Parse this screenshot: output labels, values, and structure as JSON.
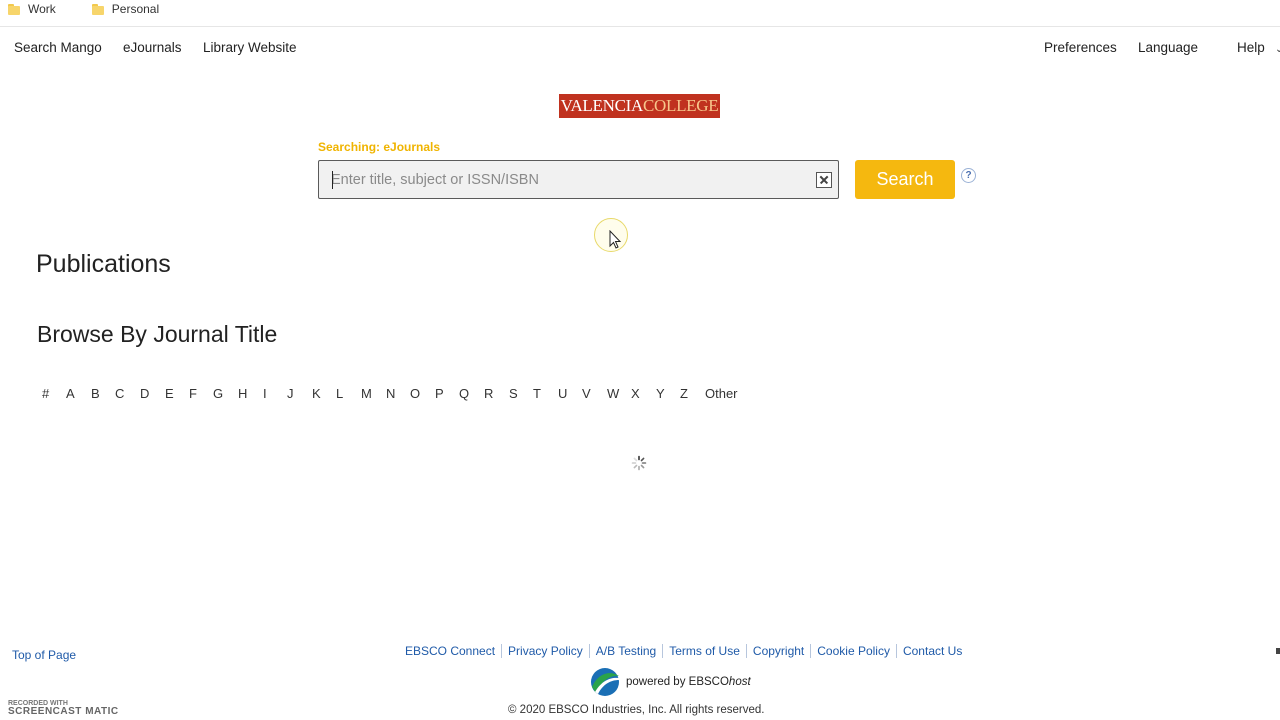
{
  "bookmarks": [
    {
      "label": "Work"
    },
    {
      "label": "Personal"
    }
  ],
  "topnav": {
    "left": [
      "Search Mango",
      "eJournals",
      "Library Website"
    ],
    "right": [
      "Preferences",
      "Language",
      "Help"
    ]
  },
  "logo": {
    "part1": "VALENCIA",
    "part2": "COLLEGE"
  },
  "search": {
    "searching_label": "Searching: eJournals",
    "placeholder": "Enter title, subject or ISSN/ISBN",
    "value": "",
    "button_label": "Search",
    "help_label": "?"
  },
  "main": {
    "publications_heading": "Publications",
    "browse_heading": "Browse By Journal Title",
    "alphabet": [
      "#",
      "A",
      "B",
      "C",
      "D",
      "E",
      "F",
      "G",
      "H",
      "I",
      "J",
      "K",
      "L",
      "M",
      "N",
      "O",
      "P",
      "Q",
      "R",
      "S",
      "T",
      "U",
      "V",
      "W",
      "X",
      "Y",
      "Z",
      "Other"
    ]
  },
  "footer": {
    "top_of_page": "Top of Page",
    "links": [
      "EBSCO Connect",
      "Privacy Policy",
      "A/B Testing",
      "Terms of Use",
      "Copyright",
      "Cookie Policy",
      "Contact Us"
    ],
    "powered_by": "powered by EBSCO",
    "powered_by_italic": "host",
    "copyright": "© 2020 EBSCO Industries, Inc. All rights reserved."
  },
  "watermark": {
    "line1": "RECORDED WITH",
    "line2": "SCREENCAST",
    "line3": "MATIC"
  },
  "colors": {
    "accent": "#f5b80f",
    "logo_bg": "#c0321f",
    "link": "#1f5aa8"
  },
  "icons": {
    "bookmark": "folder-icon",
    "clear": "clear-icon",
    "help": "help-icon",
    "loading": "spinner-icon",
    "brand": "ebsco-logo-icon"
  }
}
